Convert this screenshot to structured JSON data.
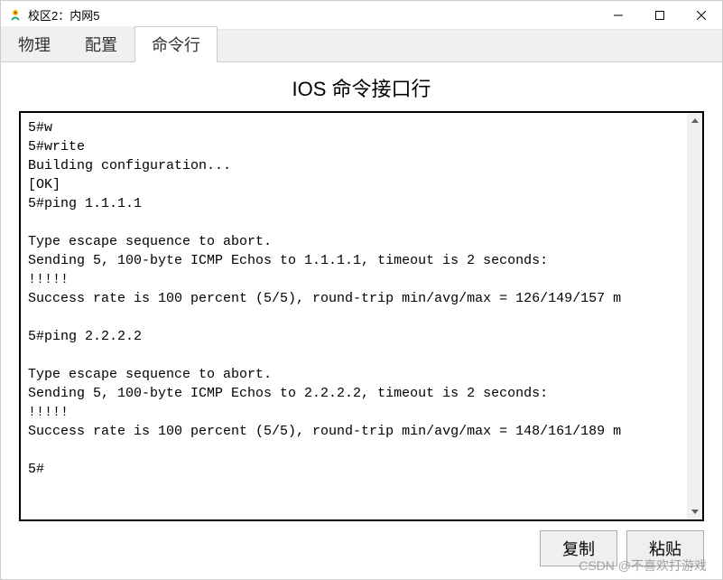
{
  "window": {
    "title": "校区2：内网5"
  },
  "tabs": {
    "physical": "物理",
    "config": "配置",
    "cli": "命令行",
    "active": "cli"
  },
  "cli": {
    "heading": "IOS 命令接口行",
    "output": "5#w\n5#write\nBuilding configuration...\n[OK]\n5#ping 1.1.1.1\n\nType escape sequence to abort.\nSending 5, 100-byte ICMP Echos to 1.1.1.1, timeout is 2 seconds:\n!!!!!\nSuccess rate is 100 percent (5/5), round-trip min/avg/max = 126/149/157 m\n\n5#ping 2.2.2.2\n\nType escape sequence to abort.\nSending 5, 100-byte ICMP Echos to 2.2.2.2, timeout is 2 seconds:\n!!!!!\nSuccess rate is 100 percent (5/5), round-trip min/avg/max = 148/161/189 m\n\n5#"
  },
  "buttons": {
    "copy": "复制",
    "paste": "粘贴"
  },
  "watermark": "CSDN @不喜欢打游戏"
}
